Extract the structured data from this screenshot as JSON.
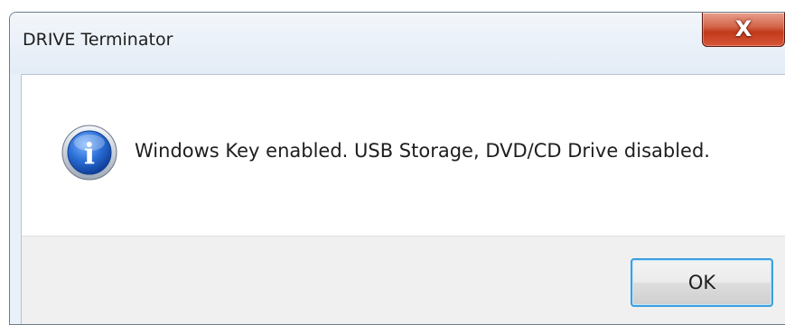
{
  "window": {
    "title": "DRIVE Terminator"
  },
  "titlebar": {
    "close_icon": "close-icon",
    "close_glyph": "X"
  },
  "message": {
    "icon": "info-icon",
    "icon_glyph": "i",
    "text": "Windows Key enabled. USB Storage, DVD/CD Drive disabled."
  },
  "buttons": {
    "ok_label": "OK"
  },
  "colors": {
    "close_button": "#c13a1a",
    "info_icon": "#1f5fc4",
    "ok_button_border": "#3c9fe0",
    "button_area": "#f0f0f0"
  }
}
